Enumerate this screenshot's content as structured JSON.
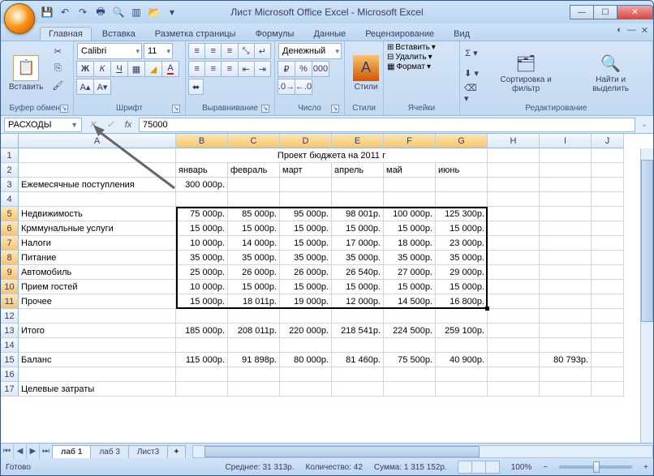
{
  "title": "Лист Microsoft Office Excel - Microsoft Excel",
  "qat_icons": [
    "save-icon",
    "undo-icon",
    "redo-icon",
    "print-icon",
    "preview-icon",
    "new-icon",
    "open-icon",
    "quick-icon"
  ],
  "tabs": [
    "Главная",
    "Вставка",
    "Разметка страницы",
    "Формулы",
    "Данные",
    "Рецензирование",
    "Вид"
  ],
  "active_tab": 0,
  "ribbon": {
    "clipboard": {
      "label": "Буфер обмена",
      "paste": "Вставить"
    },
    "font": {
      "label": "Шрифт",
      "name": "Calibri",
      "size": "11"
    },
    "align": {
      "label": "Выравнивание"
    },
    "number": {
      "label": "Число",
      "format": "Денежный"
    },
    "styles": {
      "label": "Стили",
      "btn": "Стили"
    },
    "cells": {
      "label": "Ячейки",
      "insert": "Вставить",
      "delete": "Удалить",
      "format": "Формат"
    },
    "edit": {
      "label": "Редактирование",
      "sort": "Сортировка и фильтр",
      "find": "Найти и выделить"
    }
  },
  "namebox": "РАСХОДЫ",
  "formula": "75000",
  "columns": [
    "A",
    "B",
    "C",
    "D",
    "E",
    "F",
    "G",
    "H",
    "I",
    "J"
  ],
  "rows_count": 17,
  "data": {
    "title_row": "Проект бюджета на 2011 г",
    "months": [
      "январь",
      "февраль",
      "март",
      "апрель",
      "май",
      "июнь"
    ],
    "r3a": "Ежемесячные поступления",
    "r3b": "300 000р.",
    "labels": [
      "Недвижимость",
      "Крммунальные услуги",
      "Налоги",
      "Питание",
      "Автомобиль",
      "Прием гостей",
      "Прочее"
    ],
    "vals": [
      [
        "75 000р.",
        "85 000р.",
        "95 000р.",
        "98 001р.",
        "100 000р.",
        "125 300р."
      ],
      [
        "15 000р.",
        "15 000р.",
        "15 000р.",
        "15 000р.",
        "15 000р.",
        "15 000р."
      ],
      [
        "10 000р.",
        "14 000р.",
        "15 000р.",
        "17 000р.",
        "18 000р.",
        "23 000р."
      ],
      [
        "35 000р.",
        "35 000р.",
        "35 000р.",
        "35 000р.",
        "35 000р.",
        "35 000р."
      ],
      [
        "25 000р.",
        "26 000р.",
        "26 000р.",
        "26 540р.",
        "27 000р.",
        "29 000р."
      ],
      [
        "10 000р.",
        "15 000р.",
        "15 000р.",
        "15 000р.",
        "15 000р.",
        "15 000р."
      ],
      [
        "15 000р.",
        "18 011р.",
        "19 000р.",
        "12 000р.",
        "14 500р.",
        "16 800р."
      ]
    ],
    "total_label": "Итого",
    "totals": [
      "185 000р.",
      "208 011р.",
      "220 000р.",
      "218 541р.",
      "224 500р.",
      "259 100р."
    ],
    "balance_label": "Баланс",
    "balance": [
      "115 000р.",
      "91 898р.",
      "80 000р.",
      "81 460р.",
      "75 500р.",
      "40 900р."
    ],
    "balance_i": "80 793р.",
    "targets_label": "Целевые затраты"
  },
  "sheets": [
    "лаб 1",
    "лаб 3",
    "Лист3"
  ],
  "active_sheet": 0,
  "status": {
    "ready": "Готово",
    "avg": "Среднее: 31 313р.",
    "count": "Количество: 42",
    "sum": "Сумма: 1 315 152р.",
    "zoom": "100%"
  }
}
